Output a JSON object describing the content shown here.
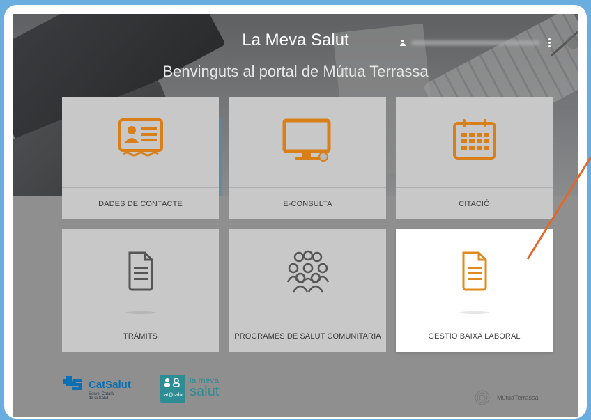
{
  "header": {
    "title": "La Meva Salut",
    "subtitle": "Benvinguts al portal de Mútua Terrassa"
  },
  "tiles": [
    {
      "label": "DADES DE CONTACTE",
      "icon": "contact-card-icon"
    },
    {
      "label": "E-CONSULTA",
      "icon": "monitor-icon"
    },
    {
      "label": "CITACIÓ",
      "icon": "calendar-icon"
    },
    {
      "label": "TRÀMITS",
      "icon": "document-icon"
    },
    {
      "label": "PROGRAMES DE SALUT COMUNITARIA",
      "icon": "community-group-icon"
    },
    {
      "label": "GESTIÓ BAIXA LABORAL",
      "icon": "document-icon"
    }
  ],
  "footer": {
    "catsalut_name": "CatSalut",
    "catsalut_sub": "Servei Català de la Salut",
    "lms_badge": "cat@salut",
    "lms_line1": "la meva",
    "lms_line2": "salut",
    "mutua_name": "MútuaTerrassa"
  },
  "colors": {
    "accent": "#e08a1e",
    "frame": "#6aaee0",
    "annotation_arrow": "#e2682a"
  }
}
